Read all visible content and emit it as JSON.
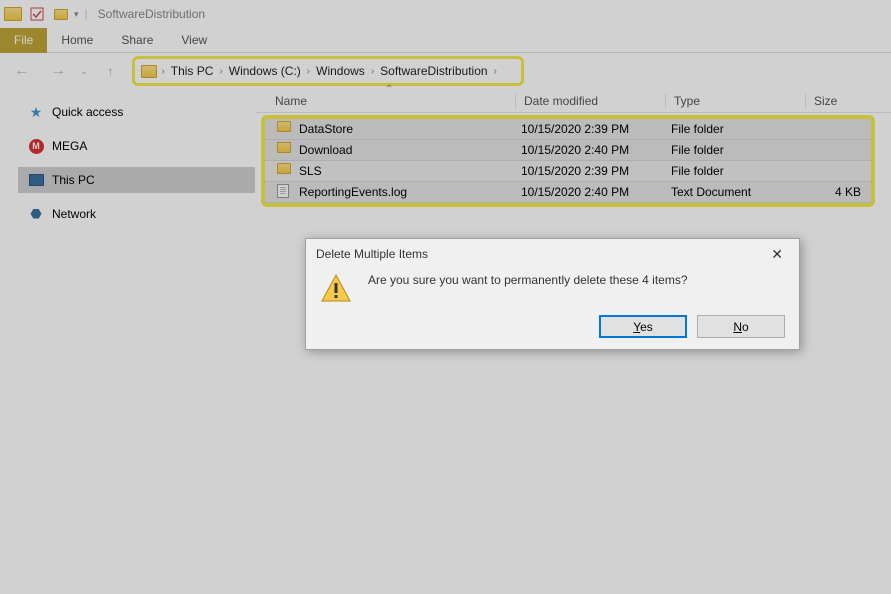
{
  "window": {
    "title": "SoftwareDistribution"
  },
  "ribbon": {
    "file": "File",
    "tabs": [
      "Home",
      "Share",
      "View"
    ]
  },
  "breadcrumb": [
    "This PC",
    "Windows (C:)",
    "Windows",
    "SoftwareDistribution"
  ],
  "sidebar": [
    {
      "label": "Quick access",
      "icon": "star"
    },
    {
      "label": "MEGA",
      "icon": "mega"
    },
    {
      "label": "This PC",
      "icon": "pc",
      "selected": true
    },
    {
      "label": "Network",
      "icon": "net"
    }
  ],
  "columns": {
    "name": "Name",
    "date": "Date modified",
    "type": "Type",
    "size": "Size"
  },
  "files": [
    {
      "name": "DataStore",
      "date": "10/15/2020 2:39 PM",
      "type": "File folder",
      "size": "",
      "icon": "folder"
    },
    {
      "name": "Download",
      "date": "10/15/2020 2:40 PM",
      "type": "File folder",
      "size": "",
      "icon": "folder"
    },
    {
      "name": "SLS",
      "date": "10/15/2020 2:39 PM",
      "type": "File folder",
      "size": "",
      "icon": "folder"
    },
    {
      "name": "ReportingEvents.log",
      "date": "10/15/2020 2:40 PM",
      "type": "Text Document",
      "size": "4 KB",
      "icon": "doc"
    }
  ],
  "dialog": {
    "title": "Delete Multiple Items",
    "message": "Are you sure you want to permanently delete these 4 items?",
    "yes": "Yes",
    "no": "No"
  }
}
